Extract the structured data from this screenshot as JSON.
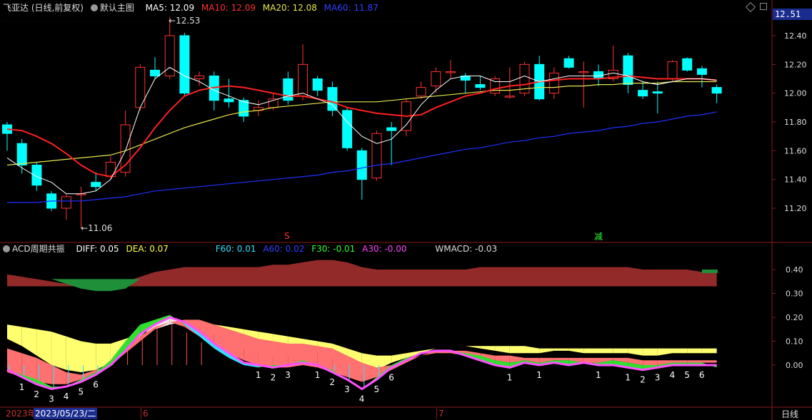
{
  "main_header": {
    "title": "飞亚达 (日线,前复权)",
    "chart_name": "默认主图",
    "ma5_label": "MA5: 12.09",
    "ma10_label": "MA10: 12.09",
    "ma20_label": "MA20: 12.08",
    "ma60_label": "MA60: 11.87"
  },
  "price_tag": "12.51",
  "price_axis": [
    "12.40",
    "12.20",
    "12.00",
    "11.80",
    "11.60",
    "11.40",
    "11.20"
  ],
  "annotations": {
    "high": "12.53",
    "low": "11.06",
    "marker_s": "S",
    "marker_jian": "减"
  },
  "sub_header": {
    "name": "ACD周期共振",
    "diff": "DIFF: 0.05",
    "dea": "DEA: 0.07",
    "f60": "F60: 0.01",
    "a60": "A60: 0.02",
    "f30": "F30: -0.01",
    "a30": "A30: -0.00",
    "wmacd": "WMACD: -0.03"
  },
  "sub_axis": [
    "0.40",
    "0.30",
    "0.20",
    "0.10",
    "0.00"
  ],
  "date_bar": {
    "year": "2023年",
    "date": "2023/05/23/二",
    "m6": "6",
    "m7": "7",
    "period": "日线"
  },
  "colors": {
    "up": "#ff3232",
    "down": "#00ffff",
    "ma5": "#ffffff",
    "ma10": "#ff2020",
    "ma20": "#e6e64c",
    "ma60": "#2030ff"
  },
  "chart_data": {
    "type": "candlestick",
    "candles": [
      {
        "o": 11.78,
        "c": 11.72,
        "h": 11.8,
        "l": 11.6
      },
      {
        "o": 11.65,
        "c": 11.5,
        "h": 11.68,
        "l": 11.44
      },
      {
        "o": 11.5,
        "c": 11.36,
        "h": 11.52,
        "l": 11.32
      },
      {
        "o": 11.3,
        "c": 11.2,
        "h": 11.32,
        "l": 11.18
      },
      {
        "o": 11.2,
        "c": 11.28,
        "h": 11.3,
        "l": 11.12
      },
      {
        "o": 11.3,
        "c": 11.3,
        "h": 11.35,
        "l": 11.06
      },
      {
        "o": 11.38,
        "c": 11.35,
        "h": 11.45,
        "l": 11.32
      },
      {
        "o": 11.42,
        "c": 11.52,
        "h": 11.56,
        "l": 11.4
      },
      {
        "o": 11.45,
        "c": 11.78,
        "h": 11.88,
        "l": 11.42
      },
      {
        "o": 11.9,
        "c": 12.18,
        "h": 12.2,
        "l": 11.88
      },
      {
        "o": 12.16,
        "c": 12.12,
        "h": 12.25,
        "l": 12.1
      },
      {
        "o": 12.12,
        "c": 12.4,
        "h": 12.53,
        "l": 12.1
      },
      {
        "o": 12.4,
        "c": 12.0,
        "h": 12.42,
        "l": 11.98
      },
      {
        "o": 12.1,
        "c": 12.12,
        "h": 12.15,
        "l": 12.05
      },
      {
        "o": 12.12,
        "c": 11.95,
        "h": 12.15,
        "l": 11.88
      },
      {
        "o": 11.96,
        "c": 11.94,
        "h": 12.1,
        "l": 11.9
      },
      {
        "o": 11.95,
        "c": 11.84,
        "h": 11.97,
        "l": 11.8
      },
      {
        "o": 11.88,
        "c": 11.9,
        "h": 11.95,
        "l": 11.84
      },
      {
        "o": 11.9,
        "c": 11.96,
        "h": 12.0,
        "l": 11.88
      },
      {
        "o": 12.1,
        "c": 11.95,
        "h": 12.15,
        "l": 11.92
      },
      {
        "o": 11.98,
        "c": 12.2,
        "h": 12.34,
        "l": 11.95
      },
      {
        "o": 12.1,
        "c": 12.02,
        "h": 12.12,
        "l": 11.98
      },
      {
        "o": 12.04,
        "c": 11.88,
        "h": 12.08,
        "l": 11.84
      },
      {
        "o": 11.88,
        "c": 11.62,
        "h": 11.9,
        "l": 11.6
      },
      {
        "o": 11.6,
        "c": 11.4,
        "h": 11.62,
        "l": 11.26
      },
      {
        "o": 11.41,
        "c": 11.72,
        "h": 11.74,
        "l": 11.39
      },
      {
        "o": 11.76,
        "c": 11.74,
        "h": 11.8,
        "l": 11.5
      },
      {
        "o": 11.74,
        "c": 11.94,
        "h": 11.96,
        "l": 11.7
      },
      {
        "o": 11.98,
        "c": 12.04,
        "h": 12.08,
        "l": 11.96
      },
      {
        "o": 12.05,
        "c": 12.15,
        "h": 12.18,
        "l": 12.0
      },
      {
        "o": 12.15,
        "c": 12.15,
        "h": 12.23,
        "l": 12.1
      },
      {
        "o": 12.12,
        "c": 12.09,
        "h": 12.14,
        "l": 12.0
      },
      {
        "o": 12.06,
        "c": 12.04,
        "h": 12.12,
        "l": 12.02
      },
      {
        "o": 12.0,
        "c": 12.1,
        "h": 12.12,
        "l": 11.98
      },
      {
        "o": 11.98,
        "c": 11.98,
        "h": 12.18,
        "l": 11.96
      },
      {
        "o": 12.0,
        "c": 12.2,
        "h": 12.22,
        "l": 11.98
      },
      {
        "o": 12.2,
        "c": 11.96,
        "h": 12.26,
        "l": 11.95
      },
      {
        "o": 12.0,
        "c": 12.14,
        "h": 12.18,
        "l": 11.96
      },
      {
        "o": 12.24,
        "c": 12.18,
        "h": 12.26,
        "l": 12.17
      },
      {
        "o": 12.15,
        "c": 12.15,
        "h": 12.22,
        "l": 11.9
      },
      {
        "o": 12.15,
        "c": 12.1,
        "h": 12.2,
        "l": 12.05
      },
      {
        "o": 12.1,
        "c": 12.16,
        "h": 12.33,
        "l": 12.08
      },
      {
        "o": 12.26,
        "c": 12.06,
        "h": 12.28,
        "l": 12.0
      },
      {
        "o": 12.02,
        "c": 11.98,
        "h": 12.08,
        "l": 11.96
      },
      {
        "o": 12.01,
        "c": 12.0,
        "h": 12.08,
        "l": 11.86
      },
      {
        "o": 12.1,
        "c": 12.22,
        "h": 12.23,
        "l": 12.08
      },
      {
        "o": 12.24,
        "c": 12.16,
        "h": 12.25,
        "l": 12.15
      },
      {
        "o": 12.17,
        "c": 12.13,
        "h": 12.19,
        "l": 12.04
      },
      {
        "o": 12.04,
        "c": 12.0,
        "h": 12.06,
        "l": 11.93
      }
    ],
    "ma5": [
      11.55,
      11.48,
      11.42,
      11.38,
      11.3,
      11.3,
      11.32,
      11.4,
      11.6,
      11.9,
      12.1,
      12.18,
      12.12,
      12.08,
      12.02,
      11.98,
      11.94,
      11.92,
      11.95,
      11.98,
      12.0,
      11.96,
      11.92,
      11.8,
      11.7,
      11.65,
      11.68,
      11.78,
      11.92,
      12.02,
      12.1,
      12.12,
      12.12,
      12.08,
      12.08,
      12.12,
      12.08,
      12.1,
      12.12,
      12.12,
      12.12,
      12.14,
      12.12,
      12.08,
      12.06,
      12.08,
      12.1,
      12.1,
      12.09
    ],
    "ma10": [
      11.75,
      11.74,
      11.7,
      11.65,
      11.58,
      11.5,
      11.44,
      11.42,
      11.5,
      11.62,
      11.76,
      11.88,
      11.98,
      12.02,
      12.04,
      12.05,
      12.04,
      12.02,
      12.0,
      11.98,
      11.98,
      11.96,
      11.94,
      11.9,
      11.88,
      11.86,
      11.85,
      11.84,
      11.85,
      11.9,
      11.94,
      11.98,
      12.0,
      12.03,
      12.05,
      12.06,
      12.08,
      12.09,
      12.1,
      12.1,
      12.1,
      12.11,
      12.12,
      12.11,
      12.1,
      12.1,
      12.1,
      12.1,
      12.09
    ],
    "ma20": [
      11.5,
      11.51,
      11.52,
      11.53,
      11.54,
      11.55,
      11.56,
      11.57,
      11.6,
      11.64,
      11.68,
      11.72,
      11.76,
      11.79,
      11.82,
      11.85,
      11.87,
      11.88,
      11.9,
      11.91,
      11.92,
      11.93,
      11.94,
      11.94,
      11.94,
      11.94,
      11.95,
      11.96,
      11.97,
      11.98,
      11.99,
      12.0,
      12.01,
      12.02,
      12.02,
      12.03,
      12.04,
      12.04,
      12.05,
      12.05,
      12.06,
      12.06,
      12.07,
      12.07,
      12.07,
      12.08,
      12.08,
      12.08,
      12.08
    ],
    "ma60": [
      11.24,
      11.24,
      11.24,
      11.25,
      11.25,
      11.25,
      11.26,
      11.27,
      11.28,
      11.3,
      11.32,
      11.33,
      11.34,
      11.35,
      11.36,
      11.37,
      11.38,
      11.39,
      11.4,
      11.41,
      11.42,
      11.43,
      11.45,
      11.46,
      11.48,
      11.5,
      11.51,
      11.53,
      11.55,
      11.57,
      11.59,
      11.61,
      11.62,
      11.64,
      11.66,
      11.67,
      11.69,
      11.7,
      11.72,
      11.73,
      11.74,
      11.76,
      11.77,
      11.79,
      11.8,
      11.82,
      11.84,
      11.85,
      11.87
    ],
    "wmacd": [
      0.38,
      0.37,
      0.36,
      0.35,
      0.34,
      0.33,
      0.32,
      0.33,
      0.35,
      0.37,
      0.39,
      0.4,
      0.41,
      0.41,
      0.41,
      0.41,
      0.41,
      0.41,
      0.42,
      0.42,
      0.43,
      0.44,
      0.44,
      0.43,
      0.41,
      0.4,
      0.4,
      0.4,
      0.4,
      0.4,
      0.4,
      0.4,
      0.41,
      0.41,
      0.41,
      0.41,
      0.41,
      0.41,
      0.41,
      0.41,
      0.41,
      0.41,
      0.41,
      0.4,
      0.4,
      0.4,
      0.4,
      0.39,
      0.39
    ],
    "diff": [
      0.11,
      0.08,
      0.04,
      0.0,
      -0.02,
      -0.03,
      -0.02,
      0.01,
      0.06,
      0.12,
      0.17,
      0.2,
      0.18,
      0.16,
      0.13,
      0.1,
      0.07,
      0.05,
      0.04,
      0.04,
      0.06,
      0.05,
      0.03,
      -0.01,
      -0.04,
      -0.02,
      0.01,
      0.03,
      0.05,
      0.07,
      0.08,
      0.08,
      0.07,
      0.06,
      0.05,
      0.05,
      0.05,
      0.06,
      0.06,
      0.05,
      0.05,
      0.05,
      0.05,
      0.04,
      0.04,
      0.05,
      0.05,
      0.05,
      0.05
    ],
    "dea": [
      0.17,
      0.16,
      0.15,
      0.14,
      0.12,
      0.1,
      0.09,
      0.09,
      0.11,
      0.13,
      0.15,
      0.17,
      0.18,
      0.18,
      0.17,
      0.16,
      0.15,
      0.14,
      0.13,
      0.12,
      0.11,
      0.1,
      0.09,
      0.07,
      0.05,
      0.04,
      0.04,
      0.05,
      0.06,
      0.07,
      0.08,
      0.08,
      0.08,
      0.08,
      0.08,
      0.08,
      0.07,
      0.07,
      0.07,
      0.07,
      0.07,
      0.07,
      0.07,
      0.07,
      0.07,
      0.07,
      0.07,
      0.07,
      0.07
    ],
    "f30": [
      -0.02,
      -0.04,
      -0.06,
      -0.09,
      -0.09,
      -0.06,
      -0.03,
      0.02,
      0.1,
      0.17,
      0.19,
      0.21,
      0.17,
      0.12,
      0.07,
      0.03,
      0.0,
      -0.01,
      0.0,
      0.0,
      0.02,
      0.0,
      -0.02,
      -0.06,
      -0.1,
      -0.05,
      0.0,
      0.03,
      0.05,
      0.06,
      0.06,
      0.05,
      0.04,
      0.02,
      0.01,
      0.02,
      0.01,
      0.02,
      0.02,
      0.01,
      0.01,
      0.02,
      0.01,
      0.0,
      0.0,
      0.01,
      0.01,
      0.01,
      -0.01
    ],
    "a30": [
      -0.02,
      -0.05,
      -0.08,
      -0.1,
      -0.09,
      -0.07,
      -0.04,
      0.0,
      0.06,
      0.13,
      0.17,
      0.2,
      0.18,
      0.14,
      0.09,
      0.05,
      0.01,
      0.0,
      -0.01,
      0.0,
      0.01,
      0.0,
      -0.03,
      -0.06,
      -0.1,
      -0.06,
      -0.01,
      0.02,
      0.05,
      0.06,
      0.06,
      0.04,
      0.02,
      0.0,
      -0.01,
      0.01,
      0.0,
      0.01,
      0.0,
      0.01,
      0.0,
      0.0,
      -0.01,
      -0.02,
      -0.01,
      0.0,
      0.0,
      0.0,
      -0.0
    ],
    "f60": [
      -0.03,
      -0.05,
      -0.07,
      -0.08,
      -0.08,
      -0.06,
      -0.03,
      0.0,
      0.06,
      0.12,
      0.16,
      0.18,
      0.16,
      0.12,
      0.08,
      0.05,
      0.02,
      0.0,
      -0.01,
      -0.01,
      0.0,
      -0.01,
      -0.03,
      -0.05,
      -0.07,
      -0.05,
      -0.02,
      0.01,
      0.04,
      0.05,
      0.05,
      0.04,
      0.03,
      0.02,
      0.01,
      0.02,
      0.01,
      0.02,
      0.02,
      0.01,
      0.01,
      0.02,
      0.01,
      0.0,
      0.0,
      0.01,
      0.01,
      0.01,
      0.01
    ],
    "a60": [
      0.07,
      0.05,
      0.03,
      0.0,
      -0.03,
      -0.04,
      -0.02,
      0.0,
      0.05,
      0.1,
      0.15,
      0.18,
      0.19,
      0.19,
      0.17,
      0.15,
      0.13,
      0.11,
      0.1,
      0.09,
      0.09,
      0.08,
      0.07,
      0.04,
      0.01,
      -0.01,
      0.0,
      0.02,
      0.04,
      0.06,
      0.06,
      0.06,
      0.05,
      0.04,
      0.04,
      0.03,
      0.03,
      0.03,
      0.03,
      0.03,
      0.03,
      0.03,
      0.03,
      0.02,
      0.02,
      0.02,
      0.02,
      0.02,
      0.02
    ],
    "cycle_labels": [
      {
        "i": 1,
        "t": "1"
      },
      {
        "i": 2,
        "t": "2"
      },
      {
        "i": 3,
        "t": "3"
      },
      {
        "i": 4,
        "t": "4"
      },
      {
        "i": 5,
        "t": "5"
      },
      {
        "i": 6,
        "t": "6"
      },
      {
        "i": 17,
        "t": "1"
      },
      {
        "i": 18,
        "t": "2"
      },
      {
        "i": 19,
        "t": "3"
      },
      {
        "i": 21,
        "t": "1"
      },
      {
        "i": 22,
        "t": "2"
      },
      {
        "i": 23,
        "t": "3"
      },
      {
        "i": 24,
        "t": "4"
      },
      {
        "i": 25,
        "t": "5"
      },
      {
        "i": 26,
        "t": "6"
      },
      {
        "i": 34,
        "t": "1"
      },
      {
        "i": 36,
        "t": "1"
      },
      {
        "i": 40,
        "t": "1"
      },
      {
        "i": 42,
        "t": "1"
      },
      {
        "i": 43,
        "t": "2"
      },
      {
        "i": 44,
        "t": "3"
      },
      {
        "i": 45,
        "t": "4"
      },
      {
        "i": 46,
        "t": "5"
      },
      {
        "i": 47,
        "t": "6"
      }
    ]
  }
}
